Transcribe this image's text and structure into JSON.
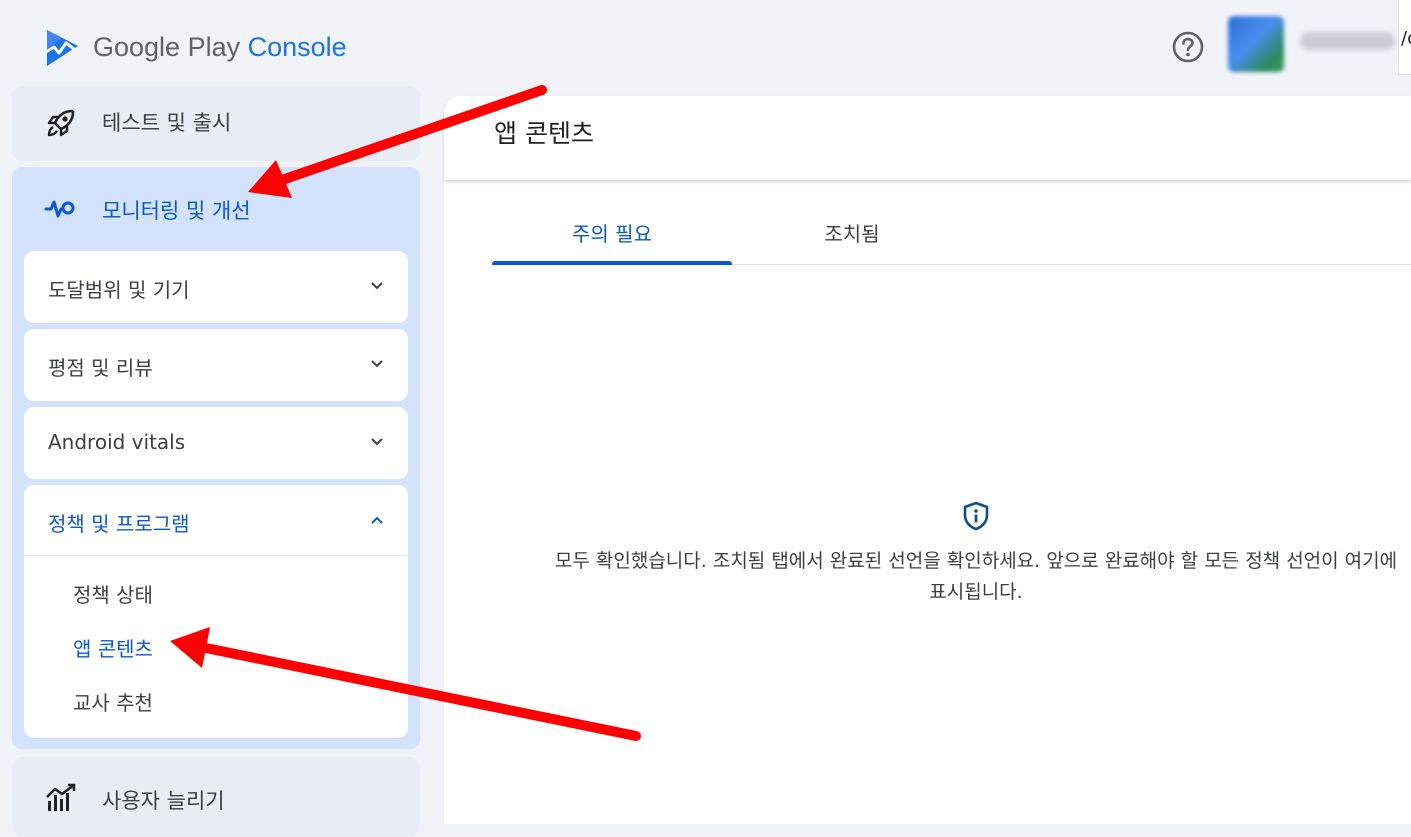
{
  "header": {
    "brand_prefix": "Google Play",
    "brand_suffix": "Console",
    "help_icon": "help-circle-icon",
    "account_label": "/c",
    "account_name_blurred": true
  },
  "sidebar": {
    "test_release": {
      "label": "테스트 및 출시",
      "icon": "rocket-icon"
    },
    "monitor": {
      "label": "모니터링 및 개선",
      "icon": "pulse-icon"
    },
    "sections": [
      {
        "label": "도달범위 및 기기",
        "expanded": false
      },
      {
        "label": "평점 및 리뷰",
        "expanded": false
      },
      {
        "label": "Android vitals",
        "expanded": false
      }
    ],
    "policy": {
      "label": "정책 및 프로그램",
      "expanded": true,
      "items": [
        {
          "label": "정책 상태",
          "active": false
        },
        {
          "label": "앱 콘텐츠",
          "active": true
        },
        {
          "label": "교사 추천",
          "active": false
        }
      ]
    },
    "grow_users": {
      "label": "사용자 늘리기",
      "icon": "growth-chart-icon"
    }
  },
  "main": {
    "title": "앱 콘텐츠",
    "tabs": [
      {
        "label": "주의 필요",
        "active": true
      },
      {
        "label": "조치됨",
        "active": false
      }
    ],
    "empty_state": {
      "icon": "shield-info-icon",
      "message": "모두 확인했습니다. 조치됨 탭에서 완료된 선언을 확인하세요. 앞으로 완료해야 할 모든 정책 선언이 여기에 표시됩니다."
    }
  },
  "annotations": {
    "arrow_color": "#ff0000",
    "arrows": [
      "arrow-to-monitoring",
      "arrow-to-app-content"
    ]
  },
  "colors": {
    "accent": "#0b57d0",
    "sidebar_active_bg": "#d3e3fd",
    "page_bg": "#f1f3f8"
  }
}
